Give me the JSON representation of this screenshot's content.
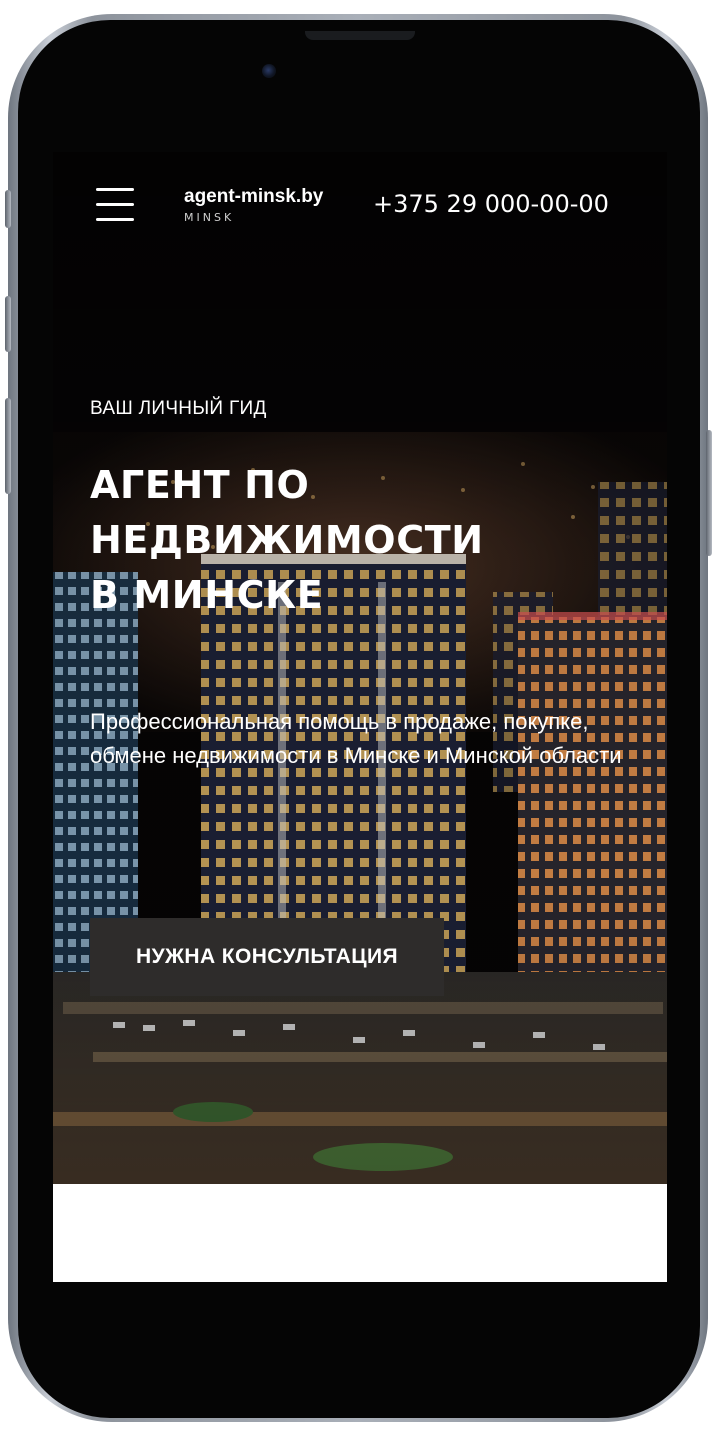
{
  "header": {
    "logo_name": "agent-minsk.by",
    "logo_city": "MINSK",
    "phone": "+375 29 000-00-00"
  },
  "hero": {
    "eyebrow": "ВАШ ЛИЧНЫЙ ГИД",
    "title_lines": [
      "АГЕНТ ПО",
      "НЕДВИЖИМОСТИ",
      "В МИНСКЕ"
    ],
    "description": "Профессиональная помощь в продаже, покупке, обмене недвижимости в Минске и Минской области",
    "cta_label": "НУЖНА КОНСУЛЬТАЦИЯ"
  },
  "icons": {
    "menu": "hamburger-menu-icon"
  },
  "colors": {
    "cta_background": "#2e2c2b",
    "hero_text": "#ffffff",
    "page_background": "#ffffff"
  }
}
